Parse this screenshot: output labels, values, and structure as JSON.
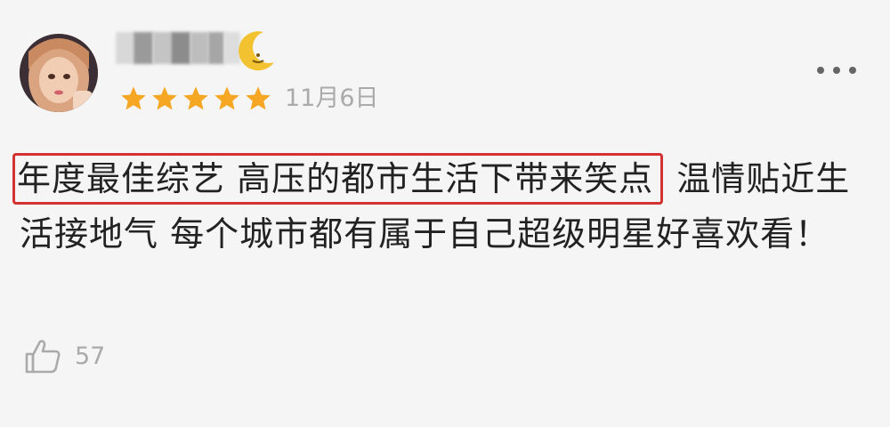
{
  "review": {
    "date": "11月6日",
    "rating": 5,
    "rating_max": 5,
    "highlighted_text": "年度最佳综艺  高压的都市生活下带来笑点",
    "rest_text": "温情贴近生活接地气 每个城市都有属于自己超级明星好喜欢看！",
    "like_count": "57"
  },
  "colors": {
    "star": "#f5a623",
    "highlight_border": "#d23232",
    "moon": "#f2c230",
    "muted_text": "#aaaaaa",
    "body_text": "#222222"
  },
  "icons": {
    "more": "more-dots-icon",
    "like": "thumbs-up-icon",
    "moon": "crescent-moon-icon",
    "star": "star-icon"
  }
}
